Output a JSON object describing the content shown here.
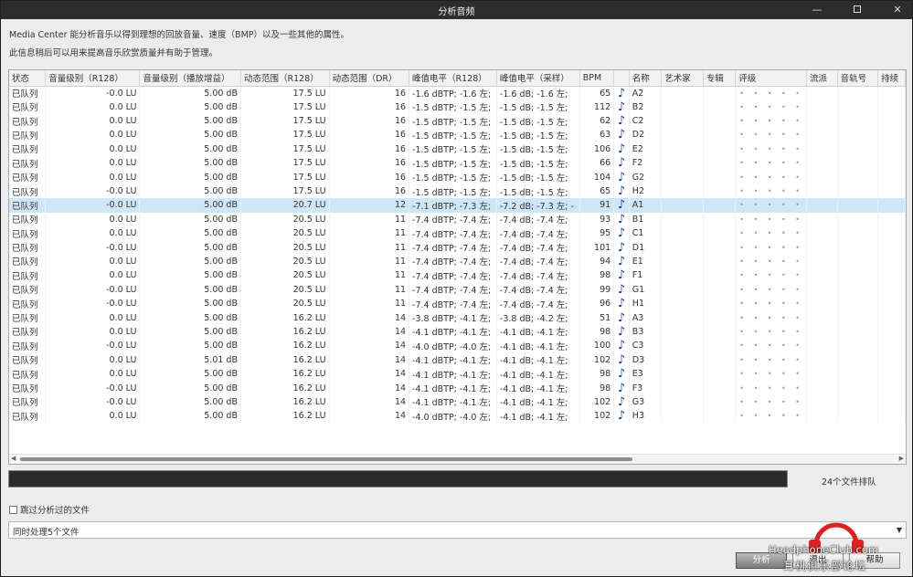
{
  "window": {
    "title": "分析音频"
  },
  "description": {
    "line1": "Media Center 能分析音乐以得到理想的回放音量、速度（BMP）以及一些其他的属性。",
    "line2": "此信息稍后可以用来提高音乐欣赏质量并有助于管理。"
  },
  "columns": [
    "状态",
    "音量级别（R128）",
    "音量级别（播放增益）",
    "动态范围（R128）",
    "动态范围（DR）",
    "峰值电平（R128）",
    "峰值电平（采样）",
    "BPM",
    "",
    "名称",
    "艺术家",
    "专辑",
    "评级",
    "流派",
    "音轨号",
    "持续"
  ],
  "rows": [
    {
      "status": "已队列",
      "r128": "-0.0 LU",
      "gain": "5.00 dB",
      "dr128": "17.5 LU",
      "dr": "16",
      "peak_r128": "-1.6 dBTP; -1.6 左;",
      "peak_sample": "-1.6 dB; -1.6 左;",
      "bpm": "65",
      "name": "A2"
    },
    {
      "status": "已队列",
      "r128": "0.0 LU",
      "gain": "5.00 dB",
      "dr128": "17.5 LU",
      "dr": "16",
      "peak_r128": "-1.5 dBTP; -1.5 左;",
      "peak_sample": "-1.5 dB; -1.5 左;",
      "bpm": "112",
      "name": "B2"
    },
    {
      "status": "已队列",
      "r128": "0.0 LU",
      "gain": "5.00 dB",
      "dr128": "17.5 LU",
      "dr": "16",
      "peak_r128": "-1.5 dBTP; -1.5 左;",
      "peak_sample": "-1.5 dB; -1.5 左;",
      "bpm": "62",
      "name": "C2"
    },
    {
      "status": "已队列",
      "r128": "0.0 LU",
      "gain": "5.00 dB",
      "dr128": "17.5 LU",
      "dr": "16",
      "peak_r128": "-1.5 dBTP; -1.5 左;",
      "peak_sample": "-1.5 dB; -1.5 左;",
      "bpm": "63",
      "name": "D2"
    },
    {
      "status": "已队列",
      "r128": "0.0 LU",
      "gain": "5.00 dB",
      "dr128": "17.5 LU",
      "dr": "16",
      "peak_r128": "-1.5 dBTP; -1.5 左;",
      "peak_sample": "-1.5 dB; -1.5 左;",
      "bpm": "106",
      "name": "E2"
    },
    {
      "status": "已队列",
      "r128": "0.0 LU",
      "gain": "5.00 dB",
      "dr128": "17.5 LU",
      "dr": "16",
      "peak_r128": "-1.5 dBTP; -1.5 左;",
      "peak_sample": "-1.5 dB; -1.5 左;",
      "bpm": "66",
      "name": "F2"
    },
    {
      "status": "已队列",
      "r128": "0.0 LU",
      "gain": "5.00 dB",
      "dr128": "17.5 LU",
      "dr": "16",
      "peak_r128": "-1.5 dBTP; -1.5 左;",
      "peak_sample": "-1.5 dB; -1.5 左;",
      "bpm": "104",
      "name": "G2"
    },
    {
      "status": "已队列",
      "r128": "-0.0 LU",
      "gain": "5.00 dB",
      "dr128": "17.5 LU",
      "dr": "16",
      "peak_r128": "-1.5 dBTP; -1.5 左;",
      "peak_sample": "-1.5 dB; -1.5 左;",
      "bpm": "65",
      "name": "H2"
    },
    {
      "status": "已队列",
      "r128": "-0.0 LU",
      "gain": "5.00 dB",
      "dr128": "20.7 LU",
      "dr": "12",
      "peak_r128": "-7.1 dBTP; -7.3 左;",
      "peak_sample": "-7.2 dB; -7.3 左; -",
      "bpm": "91",
      "name": "A1",
      "selected": true
    },
    {
      "status": "已队列",
      "r128": "0.0 LU",
      "gain": "5.00 dB",
      "dr128": "20.5 LU",
      "dr": "11",
      "peak_r128": "-7.4 dBTP; -7.4 左;",
      "peak_sample": "-7.4 dB; -7.4 左;",
      "bpm": "93",
      "name": "B1"
    },
    {
      "status": "已队列",
      "r128": "0.0 LU",
      "gain": "5.00 dB",
      "dr128": "20.5 LU",
      "dr": "11",
      "peak_r128": "-7.4 dBTP; -7.4 左;",
      "peak_sample": "-7.4 dB; -7.4 左;",
      "bpm": "95",
      "name": "C1"
    },
    {
      "status": "已队列",
      "r128": "-0.0 LU",
      "gain": "5.00 dB",
      "dr128": "20.5 LU",
      "dr": "11",
      "peak_r128": "-7.4 dBTP; -7.4 左;",
      "peak_sample": "-7.4 dB; -7.4 左;",
      "bpm": "101",
      "name": "D1"
    },
    {
      "status": "已队列",
      "r128": "0.0 LU",
      "gain": "5.00 dB",
      "dr128": "20.5 LU",
      "dr": "11",
      "peak_r128": "-7.4 dBTP; -7.4 左;",
      "peak_sample": "-7.4 dB; -7.4 左;",
      "bpm": "94",
      "name": "E1"
    },
    {
      "status": "已队列",
      "r128": "0.0 LU",
      "gain": "5.00 dB",
      "dr128": "20.5 LU",
      "dr": "11",
      "peak_r128": "-7.4 dBTP; -7.4 左;",
      "peak_sample": "-7.4 dB; -7.4 左;",
      "bpm": "98",
      "name": "F1"
    },
    {
      "status": "已队列",
      "r128": "-0.0 LU",
      "gain": "5.00 dB",
      "dr128": "20.5 LU",
      "dr": "11",
      "peak_r128": "-7.4 dBTP; -7.4 左;",
      "peak_sample": "-7.4 dB; -7.4 左;",
      "bpm": "99",
      "name": "G1"
    },
    {
      "status": "已队列",
      "r128": "-0.0 LU",
      "gain": "5.00 dB",
      "dr128": "20.5 LU",
      "dr": "11",
      "peak_r128": "-7.4 dBTP; -7.4 左;",
      "peak_sample": "-7.4 dB; -7.4 左;",
      "bpm": "96",
      "name": "H1"
    },
    {
      "status": "已队列",
      "r128": "0.0 LU",
      "gain": "5.00 dB",
      "dr128": "16.2 LU",
      "dr": "14",
      "peak_r128": "-3.8 dBTP; -4.1 左;",
      "peak_sample": "-3.8 dB; -4.2 左;",
      "bpm": "51",
      "name": "A3"
    },
    {
      "status": "已队列",
      "r128": "0.0 LU",
      "gain": "5.00 dB",
      "dr128": "16.2 LU",
      "dr": "14",
      "peak_r128": "-4.1 dBTP; -4.1 左;",
      "peak_sample": "-4.1 dB; -4.1 左;",
      "bpm": "98",
      "name": "B3"
    },
    {
      "status": "已队列",
      "r128": "-0.0 LU",
      "gain": "5.00 dB",
      "dr128": "16.2 LU",
      "dr": "14",
      "peak_r128": "-4.0 dBTP; -4.0 左;",
      "peak_sample": "-4.1 dB; -4.1 左;",
      "bpm": "100",
      "name": "C3"
    },
    {
      "status": "已队列",
      "r128": "0.0 LU",
      "gain": "5.01 dB",
      "dr128": "16.2 LU",
      "dr": "14",
      "peak_r128": "-4.1 dBTP; -4.1 左;",
      "peak_sample": "-4.1 dB; -4.1 左;",
      "bpm": "102",
      "name": "D3"
    },
    {
      "status": "已队列",
      "r128": "0.0 LU",
      "gain": "5.00 dB",
      "dr128": "16.2 LU",
      "dr": "14",
      "peak_r128": "-4.1 dBTP; -4.1 左;",
      "peak_sample": "-4.1 dB; -4.1 左;",
      "bpm": "98",
      "name": "E3"
    },
    {
      "status": "已队列",
      "r128": "-0.0 LU",
      "gain": "5.00 dB",
      "dr128": "16.2 LU",
      "dr": "14",
      "peak_r128": "-4.1 dBTP; -4.1 左;",
      "peak_sample": "-4.1 dB; -4.1 左;",
      "bpm": "98",
      "name": "F3"
    },
    {
      "status": "已队列",
      "r128": "-0.0 LU",
      "gain": "5.00 dB",
      "dr128": "16.2 LU",
      "dr": "14",
      "peak_r128": "-4.1 dBTP; -4.1 左;",
      "peak_sample": "-4.1 dB; -4.1 左;",
      "bpm": "102",
      "name": "G3"
    },
    {
      "status": "已队列",
      "r128": "0.0 LU",
      "gain": "5.00 dB",
      "dr128": "16.2 LU",
      "dr": "14",
      "peak_r128": "-4.0 dBTP; -4.0 左;",
      "peak_sample": "-4.1 dB; -4.1 左;",
      "bpm": "102",
      "name": "H3"
    }
  ],
  "row_icon": "music-note-icon",
  "rating_stars": "• • • • •",
  "progress": {
    "fraction": 1.0
  },
  "file_count": "24个文件排队",
  "skip_checkbox": {
    "label": "跳过分析过的文件",
    "checked": false
  },
  "concurrency_select": {
    "value": "同时处理5个文件"
  },
  "buttons": {
    "analyze": "分析",
    "exit": "退出",
    "help": "帮助"
  },
  "watermark": {
    "line1": "HeadphoneClub.com",
    "line2": "耳机俱乐部论坛"
  },
  "colors": {
    "titlebar": "#2d2d30",
    "selected_row": "#cfe6f7",
    "progress_fill": "#2b2b2b",
    "note": "#1a3a8a"
  }
}
